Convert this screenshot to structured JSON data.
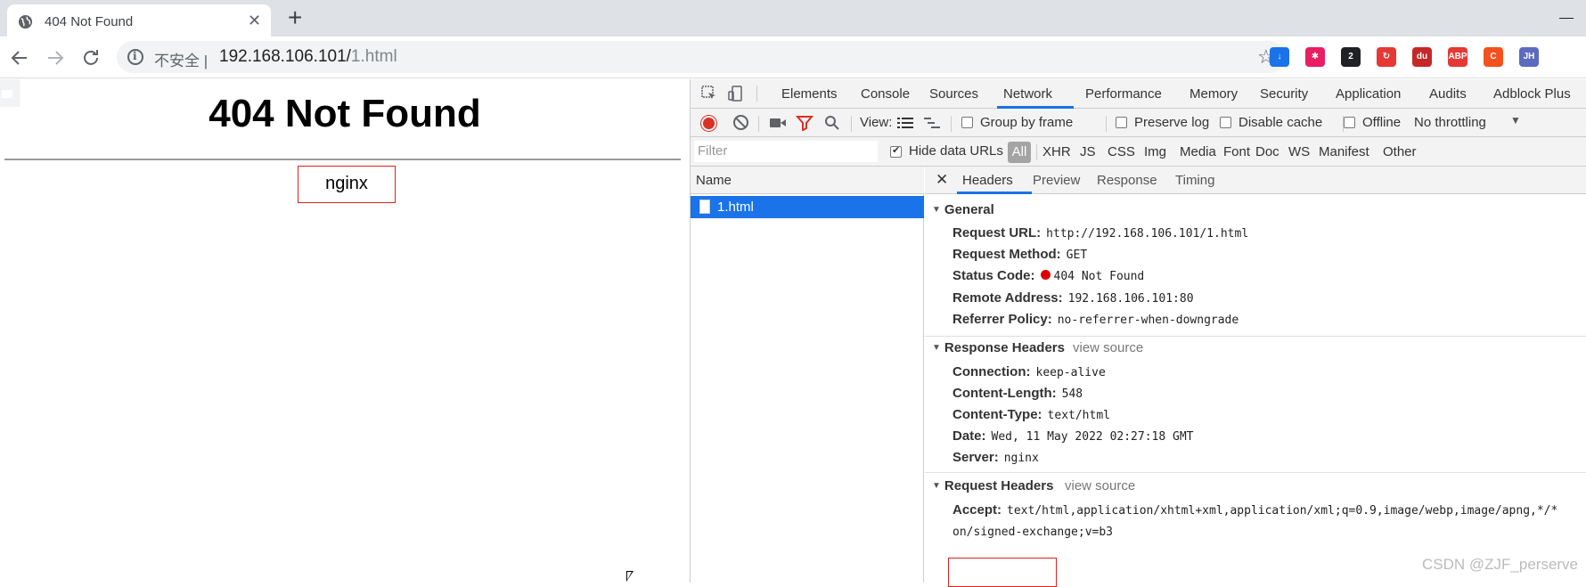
{
  "browser": {
    "tab_title": "404 Not Found",
    "tab_close": "✕",
    "new_tab": "+",
    "security_label": "不安全 |",
    "url_host": "192.168.106.101/",
    "url_path": "1.html",
    "extensions": [
      {
        "name": "download-ext",
        "label": "↓",
        "color": "#1a73e8"
      },
      {
        "name": "pinwheel-ext",
        "label": "✱",
        "color": "#e91e63"
      },
      {
        "name": "notification-ext",
        "label": "2",
        "color": "#202124"
      },
      {
        "name": "sync-ext",
        "label": "↻",
        "color": "#e53935"
      },
      {
        "name": "du-ext",
        "label": "du",
        "color": "#c62828"
      },
      {
        "name": "abp-ext",
        "label": "ABP",
        "color": "#e53935"
      },
      {
        "name": "c-ext",
        "label": "C",
        "color": "#f4511e"
      },
      {
        "name": "jh-ext",
        "label": "JH",
        "color": "#5c6bc0"
      }
    ]
  },
  "page": {
    "heading": "404 Not Found",
    "server_name": "nginx"
  },
  "devtools": {
    "tabs": [
      "Elements",
      "Console",
      "Sources",
      "Network",
      "Performance",
      "Memory",
      "Security",
      "Application",
      "Audits",
      "Adblock Plus"
    ],
    "active_tab": "Network",
    "toolbar": {
      "view_label": "View:",
      "group_by_frame": "Group by frame",
      "preserve_log": "Preserve log",
      "disable_cache": "Disable cache",
      "offline": "Offline",
      "throttling": "No throttling"
    },
    "filter": {
      "placeholder": "Filter",
      "hide_data_urls": "Hide data URLs",
      "all": "All",
      "types": [
        "XHR",
        "JS",
        "CSS",
        "Img",
        "Media",
        "Font",
        "Doc",
        "WS",
        "Manifest",
        "Other"
      ]
    },
    "name_column_header": "Name",
    "requests": [
      {
        "name": "1.html"
      }
    ],
    "detail_tabs": [
      "Headers",
      "Preview",
      "Response",
      "Timing"
    ],
    "active_detail_tab": "Headers",
    "view_source": "view source",
    "general": {
      "title": "General",
      "rows": [
        {
          "key": "Request URL:",
          "value": "http://192.168.106.101/1.html"
        },
        {
          "key": "Request Method:",
          "value": "GET"
        },
        {
          "key": "Status Code:",
          "value": "404 Not Found"
        },
        {
          "key": "Remote Address:",
          "value": "192.168.106.101:80"
        },
        {
          "key": "Referrer Policy:",
          "value": "no-referrer-when-downgrade"
        }
      ]
    },
    "response_headers": {
      "title": "Response Headers",
      "rows": [
        {
          "key": "Connection:",
          "value": "keep-alive"
        },
        {
          "key": "Content-Length:",
          "value": "548"
        },
        {
          "key": "Content-Type:",
          "value": "text/html"
        },
        {
          "key": "Date:",
          "value": "Wed, 11 May 2022 02:27:18 GMT"
        },
        {
          "key": "Server:",
          "value": "nginx"
        }
      ]
    },
    "request_headers": {
      "title": "Request Headers",
      "rows": [
        {
          "key": "Accept:",
          "value": "text/html,application/xhtml+xml,application/xml;q=0.9,image/webp,image/apng,*/*"
        },
        {
          "key": "",
          "value": "on/signed-exchange;v=b3"
        }
      ]
    }
  },
  "watermark": "CSDN @ZJF_perserve"
}
